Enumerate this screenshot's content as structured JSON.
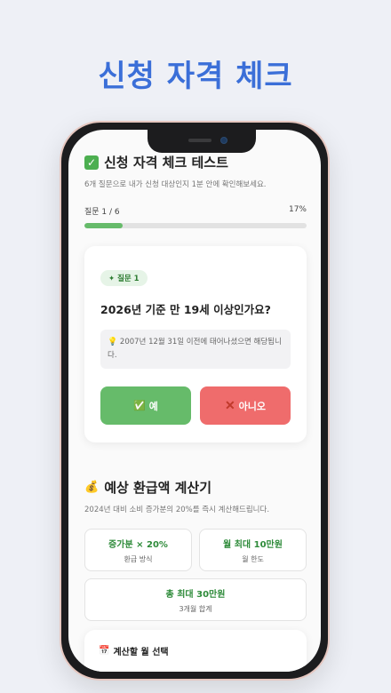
{
  "hero": {
    "title": "신청 자격 체크"
  },
  "check": {
    "title": "신청 자격 체크 테스트",
    "desc": "6개 질문으로 내가 신청 대상인지 1분 안에 확인해보세요.",
    "progress_label": "질문 1 / 6",
    "progress_percent": "17%",
    "progress_value": 0.17
  },
  "question": {
    "badge": "✦ 질문 1",
    "text": "2026년 기준 만 19세 이상인가요?",
    "hint": "2007년 12월 31일 이전에 태어나셨으면 해당됩니다.",
    "yes_label": "예",
    "no_label": "아니오"
  },
  "calculator": {
    "title": "예상 환급액 계산기",
    "desc": "2024년 대비 소비 증가분의 20%를 즉시 계산해드립니다.",
    "stats": [
      {
        "value": "증가분 × 20%",
        "label": "환급 방식"
      },
      {
        "value": "월 최대 10만원",
        "label": "월 한도"
      },
      {
        "value": "총 최대 30만원",
        "label": "3개월 합계"
      }
    ]
  },
  "month": {
    "title": "계산할 월 선택"
  },
  "icons": {
    "check": "check-square-icon",
    "bulb": "lightbulb-icon",
    "yes": "check-icon",
    "no": "x-icon",
    "money": "money-bag-icon",
    "calendar": "calendar-icon"
  },
  "colors": {
    "brand": "#3b6fd8",
    "green": "#66bb6a",
    "red": "#ef6c6c"
  }
}
